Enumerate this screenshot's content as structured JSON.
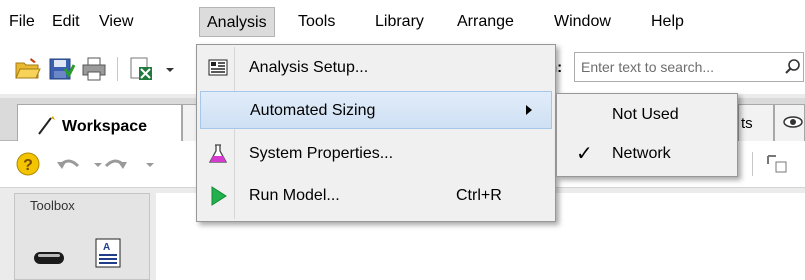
{
  "menubar": {
    "items": [
      "File",
      "Edit",
      "View",
      "Analysis",
      "Tools",
      "Library",
      "Arrange",
      "Window",
      "Help"
    ],
    "active": "Analysis"
  },
  "toolbar": {
    "icons": [
      "open-folder-icon",
      "save-icon",
      "print-icon",
      "export-excel-icon"
    ],
    "search_label": "h:",
    "search_placeholder": "Enter text to search..."
  },
  "tabs": {
    "workspace_label": "Workspace",
    "partial_tab_text": "ts"
  },
  "toolbox": {
    "title": "Toolbox"
  },
  "analysis_menu": {
    "items": [
      {
        "label": "Analysis Setup...",
        "icon": "analysis-setup-icon",
        "shortcut": ""
      },
      {
        "label": "Automated Sizing",
        "icon": "",
        "shortcut": "",
        "submenu": true
      },
      {
        "label": "System Properties...",
        "icon": "flask-icon",
        "shortcut": ""
      },
      {
        "label": "Run Model...",
        "icon": "run-triangle-icon",
        "shortcut": "Ctrl+R"
      }
    ]
  },
  "sizing_submenu": {
    "items": [
      {
        "label": "Not Used",
        "checked": false
      },
      {
        "label": "Network",
        "checked": true
      }
    ],
    "check_glyph": "✓"
  },
  "colors": {
    "menu_hover": "#d5e4f5",
    "menu_bg": "#f0f0f0",
    "run_green": "#22b14c",
    "flask_pink": "#d63ad0"
  }
}
